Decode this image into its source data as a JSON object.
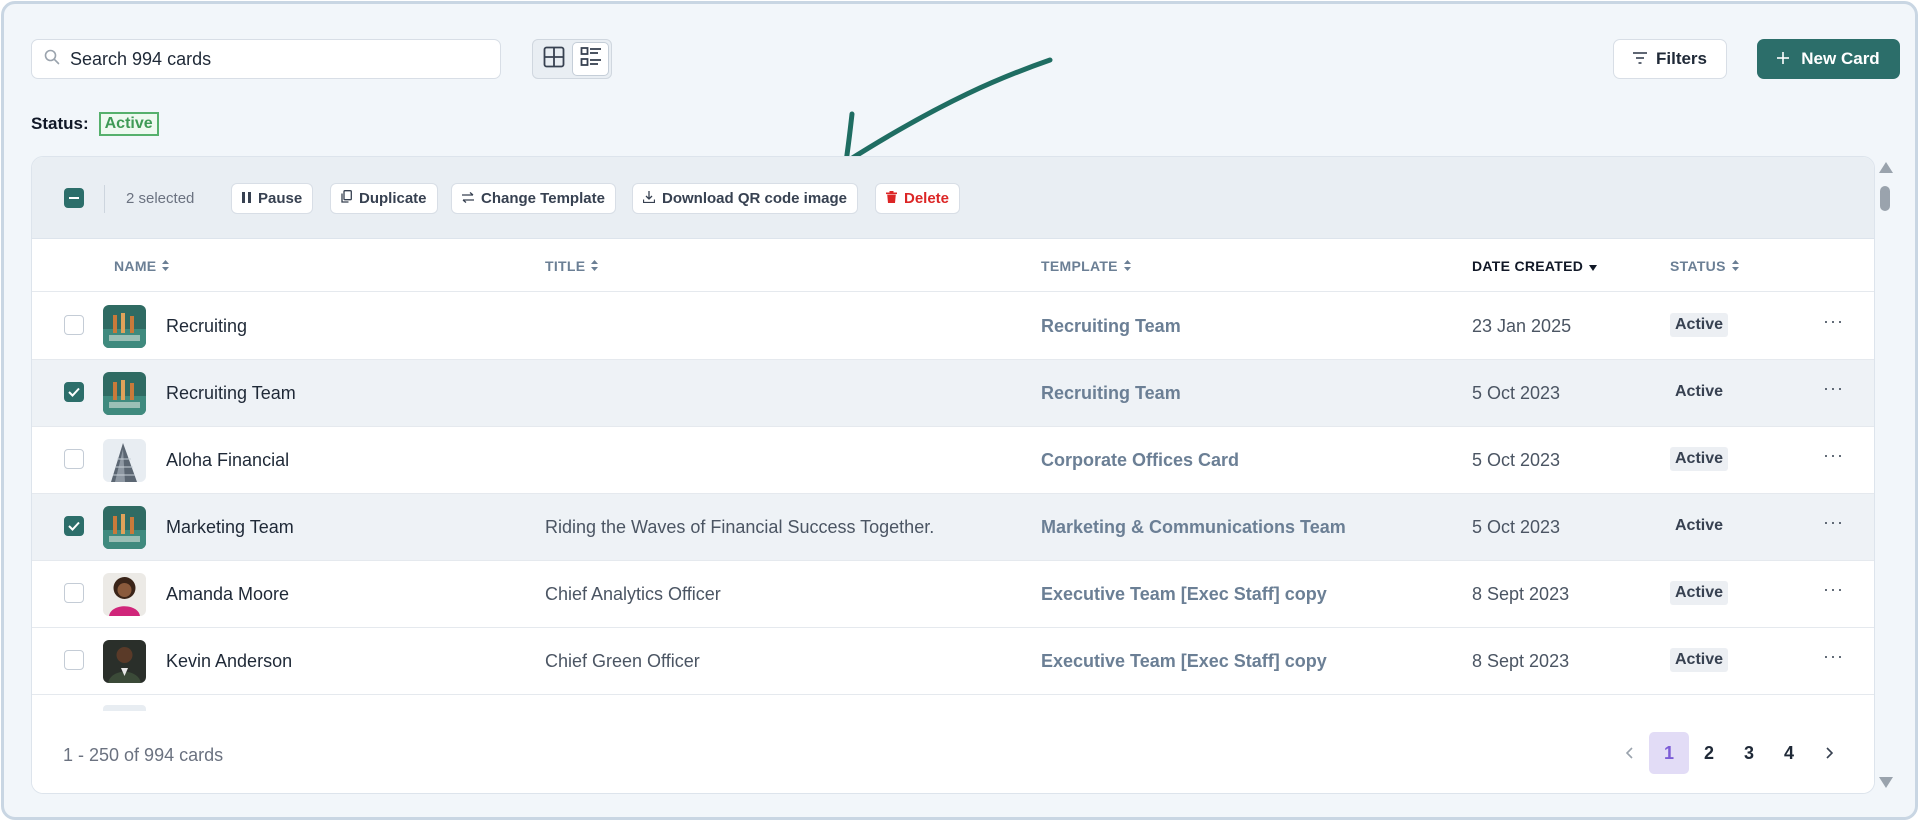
{
  "search": {
    "placeholder": "Search 994 cards",
    "icon": "search-icon"
  },
  "view_toggle": {
    "grid_icon": "grid-view-icon",
    "list_icon": "list-view-icon",
    "active": "list"
  },
  "toolbar": {
    "filters_label": "Filters",
    "new_card_label": "New Card"
  },
  "status_filter": {
    "label": "Status:",
    "value": "Active"
  },
  "bulk": {
    "selected_text": "2 selected",
    "actions": {
      "pause": "Pause",
      "duplicate": "Duplicate",
      "change_template": "Change Template",
      "download_qr": "Download QR code image",
      "delete": "Delete"
    }
  },
  "columns": {
    "name": "NAME",
    "title": "TITLE",
    "template": "TEMPLATE",
    "date_created": "DATE CREATED",
    "status": "STATUS"
  },
  "rows": [
    {
      "name": "Recruiting",
      "title": "",
      "template": "Recruiting Team",
      "date": "23 Jan 2025",
      "status": "Active",
      "selected": false
    },
    {
      "name": "Recruiting Team",
      "title": "",
      "template": "Recruiting Team",
      "date": "5 Oct 2023",
      "status": "Active",
      "selected": true
    },
    {
      "name": "Aloha Financial",
      "title": "",
      "template": "Corporate Offices Card",
      "date": "5 Oct 2023",
      "status": "Active",
      "selected": false
    },
    {
      "name": "Marketing Team",
      "title": "Riding the Waves of Financial Success Together.",
      "template": "Marketing & Communications Team",
      "date": "5 Oct 2023",
      "status": "Active",
      "selected": true
    },
    {
      "name": "Amanda Moore",
      "title": "Chief Analytics Officer",
      "template": "Executive Team [Exec Staff] copy",
      "date": "8 Sept 2023",
      "status": "Active",
      "selected": false
    },
    {
      "name": "Kevin Anderson",
      "title": "Chief Green Officer",
      "template": "Executive Team [Exec Staff] copy",
      "date": "8 Sept 2023",
      "status": "Active",
      "selected": false
    }
  ],
  "footer": {
    "range_text": "1 - 250 of 994 cards",
    "pages": [
      "1",
      "2",
      "3",
      "4"
    ],
    "current_page": "1"
  },
  "colors": {
    "accent": "#2c6e6a",
    "active_green": "#3f9a56",
    "page_highlight": "#e2dcf6"
  }
}
